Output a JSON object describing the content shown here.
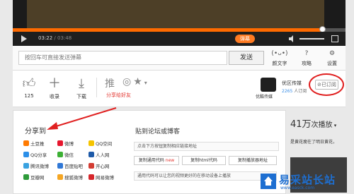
{
  "player": {
    "time_current": "03:22",
    "time_total": "/ 03:48",
    "progress": 0.93,
    "danmaku_label": "弹幕",
    "comment_placeholder": "按回车可直接发送弹幕",
    "send_label": "发送",
    "tools": [
      {
        "icon": "(•ᴗ•)",
        "label": "颜文字"
      },
      {
        "icon": "?",
        "label": "攻略"
      },
      {
        "icon": "⚙",
        "label": "设置"
      }
    ]
  },
  "actions": {
    "like_count": "125",
    "favorite_label": "收录",
    "download_label": "下载",
    "push_label": "推",
    "share_label": "分享给好友"
  },
  "uploader": {
    "avatar_label": "优酷传媒",
    "name": "优区传媒",
    "count": "2265",
    "count_suffix": "人订阅",
    "subscribed_label": "已订阅"
  },
  "share_popup": {
    "title": "分享到",
    "items": [
      "土豆推",
      "微博",
      "QQ空间",
      "QQ分享",
      "微信",
      "人人网",
      "腾讯微博",
      "百度贴吧",
      "开心网",
      "豆瓣网",
      "搜狐微博",
      "网易微博"
    ],
    "forum_title": "贴到论坛或博客",
    "link_hint": "点击下方按钮复制相应链接地址",
    "copy_general": "复制通用代码",
    "copy_general_badge": "new",
    "copy_html": "复制html代码",
    "copy_player": "复制播放器地址",
    "general_note": "通用代码可以让您的视频更好的在移动设备上播放"
  },
  "side": {
    "views_prefix": "41万",
    "views_suffix": "次播放",
    "text": "是黄花瘦在了明日黄花，"
  },
  "watermark": {
    "text": "易采站长站",
    "url": "www.easck.com"
  },
  "colors": {
    "accent": "#ff6a00",
    "share_red": "#e3322c",
    "highlight_circle": "#e02020",
    "link_blue": "#3a8ee6",
    "watermark_blue": "#1e6fd1"
  }
}
